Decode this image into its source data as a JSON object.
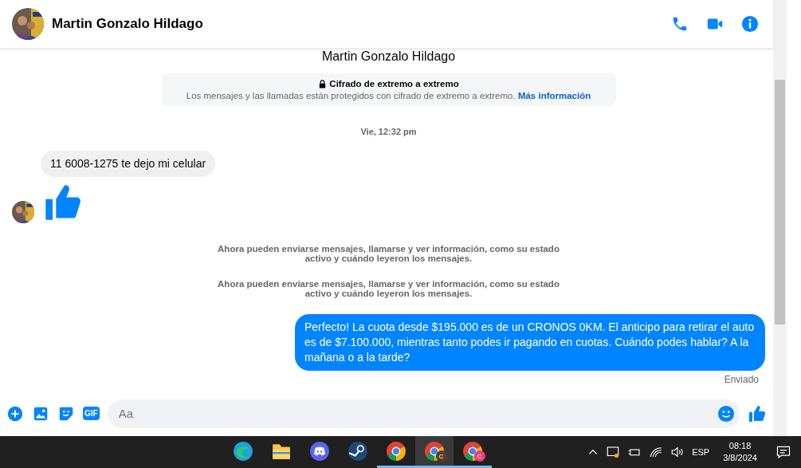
{
  "header": {
    "name": "Martin Gonzalo Hildago"
  },
  "chat": {
    "top_name": "Martin Gonzalo Hildago",
    "encryption": {
      "title": "Cifrado de extremo a extremo",
      "text": "Los mensajes y las llamadas están protegidos con cifrado de extremo a extremo.",
      "link": "Más información"
    },
    "items": [
      {
        "kind": "time",
        "text": "Vie, 12:32 pm"
      },
      {
        "kind": "incoming",
        "text": "11 6008-1275 te dejo mi celular"
      },
      {
        "kind": "like"
      },
      {
        "kind": "notice",
        "text": "Ahora pueden enviarse mensajes, llamarse y ver información, como su estado activo y cuándo leyeron los mensajes."
      },
      {
        "kind": "notice",
        "text": "Ahora pueden enviarse mensajes, llamarse y ver información, como su estado activo y cuándo leyeron los mensajes."
      },
      {
        "kind": "outgoing",
        "text": "Perfecto! La cuota desde $195.000 es de un CRONOS 0KM. El anticipo para retirar el auto es de $7.100.000, mientras tanto podes ir pagando en cuotas. Cuándo podes hablar? A la mañana o a la tarde?"
      },
      {
        "kind": "status",
        "text": "Enviado"
      }
    ]
  },
  "composer": {
    "placeholder": "Aa",
    "gif": "GIF"
  },
  "taskbar": {
    "apps": [
      {
        "kind": "edge",
        "selected": false,
        "running": false
      },
      {
        "kind": "folder",
        "selected": false,
        "running": false
      },
      {
        "kind": "discord",
        "selected": false,
        "running": false
      },
      {
        "kind": "steam",
        "selected": false,
        "running": false
      },
      {
        "kind": "chrome",
        "selected": false,
        "running": true
      },
      {
        "kind": "chrome",
        "badge": "C",
        "selected": true,
        "running": true
      },
      {
        "kind": "chrome",
        "badge": "C",
        "selected": false,
        "running": true
      }
    ],
    "language": "ESP",
    "time": "08:18",
    "date": "3/8/2024"
  }
}
